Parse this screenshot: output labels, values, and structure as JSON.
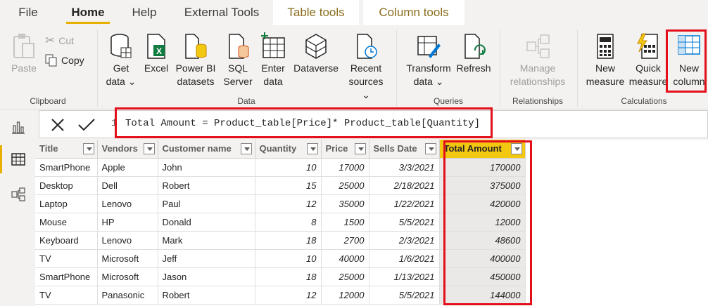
{
  "tabs": [
    {
      "label": "File"
    },
    {
      "label": "Home"
    },
    {
      "label": "Help"
    },
    {
      "label": "External Tools"
    },
    {
      "label": "Table tools"
    },
    {
      "label": "Column tools"
    }
  ],
  "ribbon": {
    "clipboard": {
      "paste": "Paste",
      "cut": "Cut",
      "copy": "Copy",
      "label": "Clipboard"
    },
    "data": {
      "get_data": [
        "Get",
        "data"
      ],
      "excel": "Excel",
      "powerbi": [
        "Power BI",
        "datasets"
      ],
      "sql": [
        "SQL",
        "Server"
      ],
      "enter": [
        "Enter",
        "data"
      ],
      "dataverse": "Dataverse",
      "recent": [
        "Recent",
        "sources"
      ],
      "label": "Data"
    },
    "queries": {
      "transform": [
        "Transform",
        "data"
      ],
      "refresh": "Refresh",
      "label": "Queries"
    },
    "relationships": {
      "manage": [
        "Manage",
        "relationships"
      ],
      "label": "Relationships"
    },
    "calculations": {
      "new_measure": [
        "New",
        "measure"
      ],
      "quick_measure": [
        "Quick",
        "measure"
      ],
      "new_column": [
        "New",
        "column"
      ],
      "label": "Calculations"
    }
  },
  "formula": {
    "line_number": "1",
    "expression": "Total Amount = Product_table[Price]* Product_table[Quantity]"
  },
  "table": {
    "columns": [
      "Title",
      "Vendors",
      "Customer name",
      "Quantity",
      "Price",
      "Sells Date",
      "Total Amount"
    ],
    "rows": [
      [
        "SmartPhone",
        "Apple",
        "John",
        "10",
        "17000",
        "3/3/2021",
        "170000"
      ],
      [
        "Desktop",
        "Dell",
        "Robert",
        "15",
        "25000",
        "2/18/2021",
        "375000"
      ],
      [
        "Laptop",
        "Lenovo",
        "Paul",
        "12",
        "35000",
        "1/22/2021",
        "420000"
      ],
      [
        "Mouse",
        "HP",
        "Donald",
        "8",
        "1500",
        "5/5/2021",
        "12000"
      ],
      [
        "Keyboard",
        "Lenovo",
        "Mark",
        "18",
        "2700",
        "2/3/2021",
        "48600"
      ],
      [
        "TV",
        "Microsoft",
        "Jeff",
        "10",
        "40000",
        "1/6/2021",
        "400000"
      ],
      [
        "SmartPhone",
        "Microsoft",
        "Jason",
        "18",
        "25000",
        "1/13/2021",
        "450000"
      ],
      [
        "TV",
        "Panasonic",
        "Robert",
        "12",
        "12000",
        "5/5/2021",
        "144000"
      ]
    ]
  },
  "colors": {
    "accent": "#e8b000",
    "highlight_header": "#f2c811",
    "annotation": "#e3101b"
  }
}
